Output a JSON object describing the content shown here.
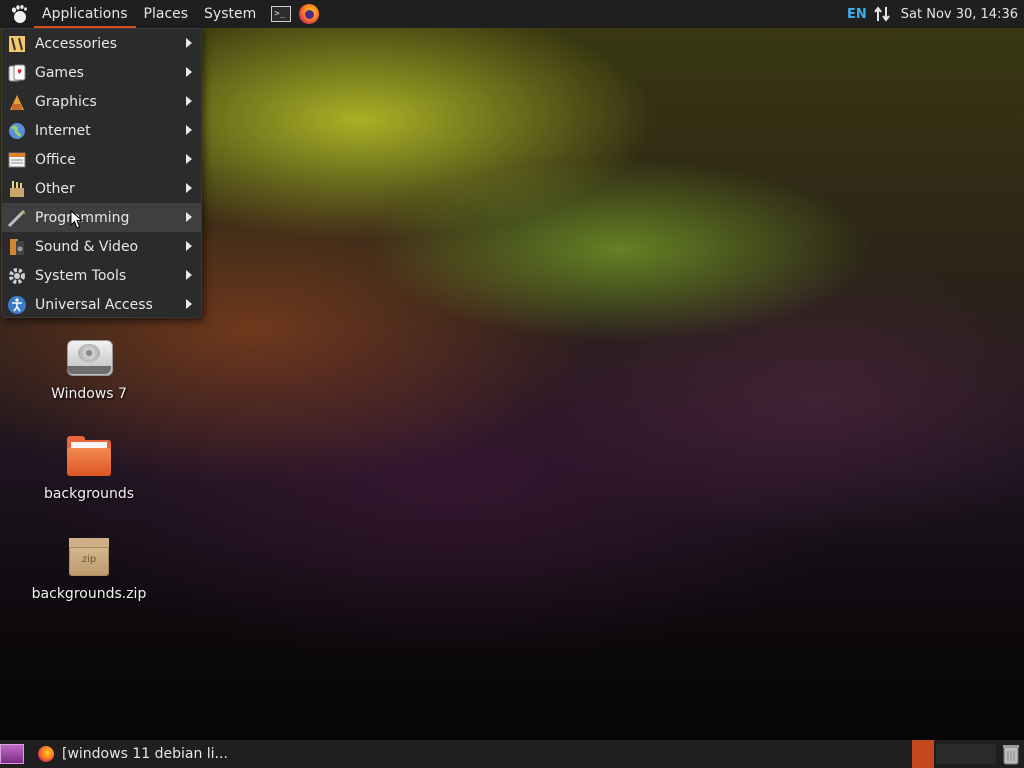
{
  "top_panel": {
    "menus": [
      {
        "label": "Applications",
        "active": true
      },
      {
        "label": "Places"
      },
      {
        "label": "System"
      }
    ],
    "launchers": [
      "terminal-icon",
      "firefox-icon"
    ],
    "language": "EN",
    "clock": "Sat Nov 30, 14:36"
  },
  "applications_menu": {
    "items": [
      {
        "label": "Accessories",
        "icon": "accessories-icon"
      },
      {
        "label": "Games",
        "icon": "games-icon"
      },
      {
        "label": "Graphics",
        "icon": "graphics-icon"
      },
      {
        "label": "Internet",
        "icon": "internet-icon"
      },
      {
        "label": "Office",
        "icon": "office-icon"
      },
      {
        "label": "Other",
        "icon": "other-icon"
      },
      {
        "label": "Programming",
        "icon": "programming-icon",
        "hovered": true
      },
      {
        "label": "Sound & Video",
        "icon": "sound-video-icon"
      },
      {
        "label": "System Tools",
        "icon": "system-tools-icon"
      },
      {
        "label": "Universal Access",
        "icon": "universal-access-icon"
      }
    ]
  },
  "desktop": {
    "icons": [
      {
        "label": "Windows 7",
        "icon": "drive-icon"
      },
      {
        "label": "backgrounds",
        "icon": "folder-icon"
      },
      {
        "label": "backgrounds.zip",
        "icon": "zip-archive-icon",
        "badge": "zip"
      }
    ]
  },
  "bottom_panel": {
    "taskbar_items": [
      {
        "label": "[windows 11 debian li...",
        "icon": "firefox-icon"
      }
    ],
    "colors": {
      "active_workspace": "#c4491f",
      "accent": "#e95420"
    }
  }
}
